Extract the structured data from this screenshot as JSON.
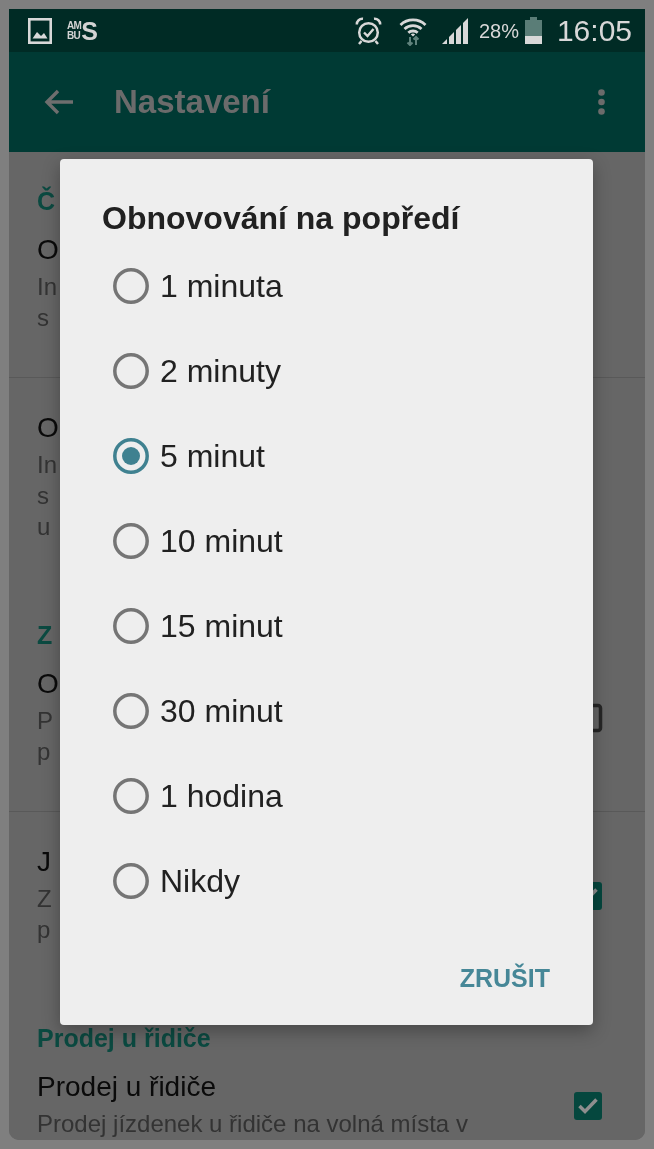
{
  "status_bar": {
    "app_logo": {
      "top": "AM",
      "bottom": "BU",
      "side": "S"
    },
    "battery": "28%",
    "time": "16:05"
  },
  "app_bar": {
    "title": "Nastavení"
  },
  "settings": [
    {
      "kind": "header",
      "text": "Č"
    },
    {
      "kind": "text",
      "title": "O",
      "summary": [
        "In",
        "s"
      ]
    },
    {
      "kind": "text",
      "title": "O",
      "summary": [
        "In",
        "s",
        "u"
      ]
    },
    {
      "kind": "header",
      "text": "Z"
    },
    {
      "kind": "checkbox",
      "title": "O",
      "summary": [
        "P",
        "p"
      ],
      "checked": false
    },
    {
      "kind": "checkbox",
      "title": "J",
      "summary": [
        "Z",
        "p"
      ],
      "checked": true
    },
    {
      "kind": "header",
      "text": "Prodej u řidiče"
    },
    {
      "kind": "checkbox",
      "title": "Prodej u řidiče",
      "summary": [
        "Prodej jízdenek u řidiče na volná místa v"
      ],
      "checked": true
    }
  ],
  "dialog": {
    "title": "Obnovování na popředí",
    "options": [
      {
        "label": "1 minuta",
        "selected": false
      },
      {
        "label": "2 minuty",
        "selected": false
      },
      {
        "label": "5 minut",
        "selected": true
      },
      {
        "label": "10 minut",
        "selected": false
      },
      {
        "label": "15 minut",
        "selected": false
      },
      {
        "label": "30 minut",
        "selected": false
      },
      {
        "label": "1 hodina",
        "selected": false
      },
      {
        "label": "Nikdy",
        "selected": false
      }
    ],
    "buttons": [
      {
        "kind": "cancel",
        "label": "ZRUŠIT"
      }
    ]
  }
}
